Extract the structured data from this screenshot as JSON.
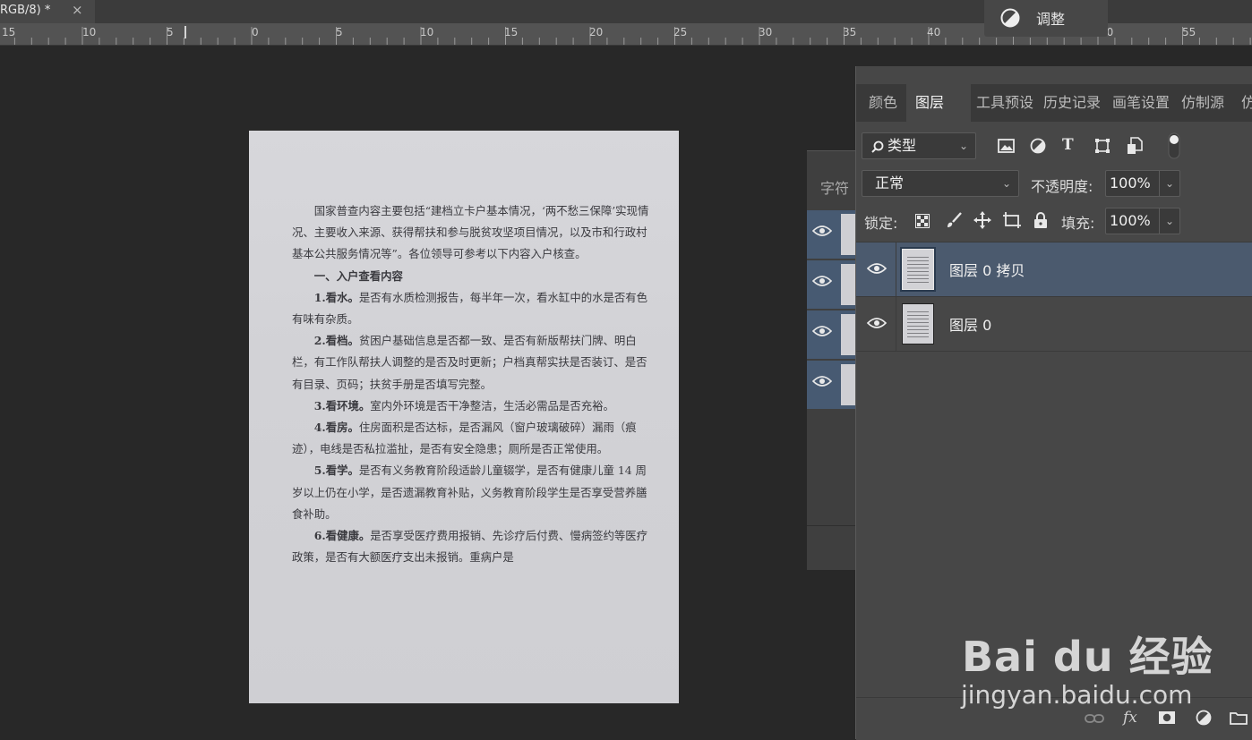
{
  "document_tab": {
    "label": "RGB/8) *",
    "close_glyph": "×"
  },
  "ruler": {
    "labels": [
      "15",
      "10",
      "5",
      "0",
      "5",
      "10",
      "15",
      "20",
      "25",
      "30",
      "35",
      "40",
      "50",
      "55"
    ]
  },
  "adjust_menu": {
    "icon": "half-circle-icon",
    "label": "调整"
  },
  "char_panel": {
    "tab_label": "字符"
  },
  "layers_panel": {
    "tabs": [
      "颜色",
      "图层",
      "工具预设",
      "历史记录",
      "画笔设置",
      "仿制源",
      "仿"
    ],
    "active_tab": "图层",
    "filter": {
      "label": "类型",
      "icon": "search-icon"
    },
    "filter_icons": [
      "image-filter-icon",
      "adjustment-filter-icon",
      "type-filter-icon",
      "shape-filter-icon",
      "smart-object-filter-icon",
      "toggle-filter-icon"
    ],
    "blend_mode": "正常",
    "opacity_label": "不透明度:",
    "opacity_value": "100%",
    "lock_label": "锁定:",
    "lock_icons": [
      "lock-transparent-icon",
      "lock-paint-icon",
      "lock-position-icon",
      "lock-artboard-icon",
      "lock-all-icon"
    ],
    "fill_label": "填充:",
    "fill_value": "100%",
    "layers": [
      {
        "name": "图层 0 拷贝",
        "selected": true,
        "visible": true
      },
      {
        "name": "图层 0",
        "selected": false,
        "visible": true
      }
    ],
    "footer_icons": [
      "link-icon",
      "fx-icon",
      "mask-icon",
      "new-adjustment-icon",
      "folder-icon"
    ],
    "footer_fx": "fx"
  },
  "document_text": {
    "intro": "国家普查内容主要包括“建档立卡户基本情况，‘两不愁三保障’实现情况、主要收入来源、获得帮扶和参与脱贫攻坚项目情况，以及市和行政村基本公共服务情况等”。各位领导可参考以下内容入户核查。",
    "heading": "一、入户查看内容",
    "items": [
      {
        "title": "1.看水。",
        "body": "是否有水质检测报告，每半年一次，看水缸中的水是否有色有味有杂质。"
      },
      {
        "title": "2.看档。",
        "body": "贫困户基础信息是否都一致、是否有新版帮扶门牌、明白栏，有工作队帮扶人调整的是否及时更新；户档真帮实扶是否装订、是否有目录、页码；扶贫手册是否填写完整。"
      },
      {
        "title": "3.看环境。",
        "body": "室内外环境是否干净整洁，生活必需品是否充裕。"
      },
      {
        "title": "4.看房。",
        "body": "住房面积是否达标，是否漏风（窗户玻璃破碎）漏雨（痕迹），电线是否私拉滥扯，是否有安全隐患；厕所是否正常使用。"
      },
      {
        "title": "5.看学。",
        "body": "是否有义务教育阶段适龄儿童辍学，是否有健康儿童 14 周岁以上仍在小学，是否遗漏教育补贴，义务教育阶段学生是否享受营养膳食补助。"
      },
      {
        "title": "6.看健康。",
        "body": "是否享受医疗费用报销、先诊疗后付费、慢病签约等医疗政策，是否有大额医疗支出未报销。重病户是"
      }
    ]
  },
  "watermark": {
    "logo": "Bai du 经验",
    "url": "jingyan.baidu.com"
  }
}
